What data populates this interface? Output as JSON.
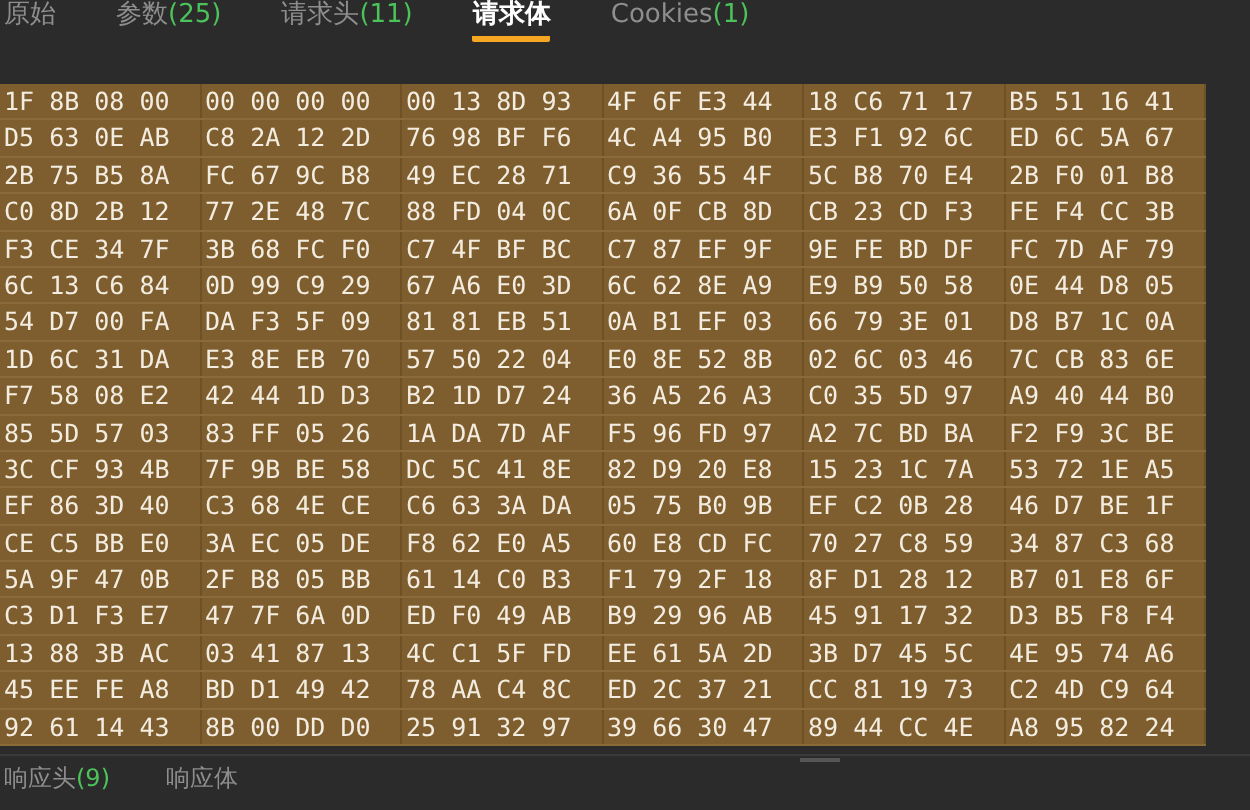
{
  "request_tabs": [
    {
      "label": "原始",
      "selected": false
    },
    {
      "label": "参数",
      "count": "(25)",
      "selected": false
    },
    {
      "label": "请求头",
      "count": "(11)",
      "selected": false
    },
    {
      "label": "请求体",
      "selected": true
    },
    {
      "label": "Cookies",
      "count": "(1)",
      "selected": false
    }
  ],
  "hex_rows": [
    [
      "1F 8B 08 00",
      "00 00 00 00",
      "00 13 8D 93",
      "4F 6F E3 44",
      "18 C6 71 17",
      "B5 51 16 41"
    ],
    [
      "D5 63 0E AB",
      "C8 2A 12 2D",
      "76 98 BF F6",
      "4C A4 95 B0",
      "E3 F1 92 6C",
      "ED 6C 5A 67"
    ],
    [
      "2B 75 B5 8A",
      "FC 67 9C B8",
      "49 EC 28 71",
      "C9 36 55 4F",
      "5C B8 70 E4",
      "2B F0 01 B8"
    ],
    [
      "C0 8D 2B 12",
      "77 2E 48 7C",
      "88 FD 04 0C",
      "6A 0F CB 8D",
      "CB 23 CD F3",
      "FE F4 CC 3B"
    ],
    [
      "F3 CE 34 7F",
      "3B 68 FC F0",
      "C7 4F BF BC",
      "C7 87 EF 9F",
      "9E FE BD DF",
      "FC 7D AF 79"
    ],
    [
      "6C 13 C6 84",
      "0D 99 C9 29",
      "67 A6 E0 3D",
      "6C 62 8E A9",
      "E9 B9 50 58",
      "0E 44 D8 05"
    ],
    [
      "54 D7 00 FA",
      "DA F3 5F 09",
      "81 81 EB 51",
      "0A B1 EF 03",
      "66 79 3E 01",
      "D8 B7 1C 0A"
    ],
    [
      "1D 6C 31 DA",
      "E3 8E EB 70",
      "57 50 22 04",
      "E0 8E 52 8B",
      "02 6C 03 46",
      "7C CB 83 6E"
    ],
    [
      "F7 58 08 E2",
      "42 44 1D D3",
      "B2 1D D7 24",
      "36 A5 26 A3",
      "C0 35 5D 97",
      "A9 40 44 B0"
    ],
    [
      "85 5D 57 03",
      "83 FF 05 26",
      "1A DA 7D AF",
      "F5 96 FD 97",
      "A2 7C BD BA",
      "F2 F9 3C BE"
    ],
    [
      "3C CF 93 4B",
      "7F 9B BE 58",
      "DC 5C 41 8E",
      "82 D9 20 E8",
      "15 23 1C 7A",
      "53 72 1E A5"
    ],
    [
      "EF 86 3D 40",
      "C3 68 4E CE",
      "C6 63 3A DA",
      "05 75 B0 9B",
      "EF C2 0B 28",
      "46 D7 BE 1F"
    ],
    [
      "CE C5 BB E0",
      "3A EC 05 DE",
      "F8 62 E0 A5",
      "60 E8 CD FC",
      "70 27 C8 59",
      "34 87 C3 68"
    ],
    [
      "5A 9F 47 0B",
      "2F B8 05 BB",
      "61 14 C0 B3",
      "F1 79 2F 18",
      "8F D1 28 12",
      "B7 01 E8 6F"
    ],
    [
      "C3 D1 F3 E7",
      "47 7F 6A 0D",
      "ED F0 49 AB",
      "B9 29 96 AB",
      "45 91 17 32",
      "D3 B5 F8 F4"
    ],
    [
      "13 88 3B AC",
      "03 41 87 13",
      "4C C1 5F FD",
      "EE 61 5A 2D",
      "3B D7 45 5C",
      "4E 95 74 A6"
    ],
    [
      "45 EE FE A8",
      "BD D1 49 42",
      "78 AA C4 8C",
      "ED 2C 37 21",
      "CC 81 19 73",
      "C2 4D C9 64"
    ],
    [
      "92 61 14 43",
      "8B 00 DD D0",
      "25 91 32 97",
      "39 66 30 47",
      "89 44 CC 4E",
      "A8 95 82 24"
    ]
  ],
  "response_tabs": [
    {
      "label": "响应头",
      "count": "(9)"
    },
    {
      "label": "响应体"
    }
  ]
}
